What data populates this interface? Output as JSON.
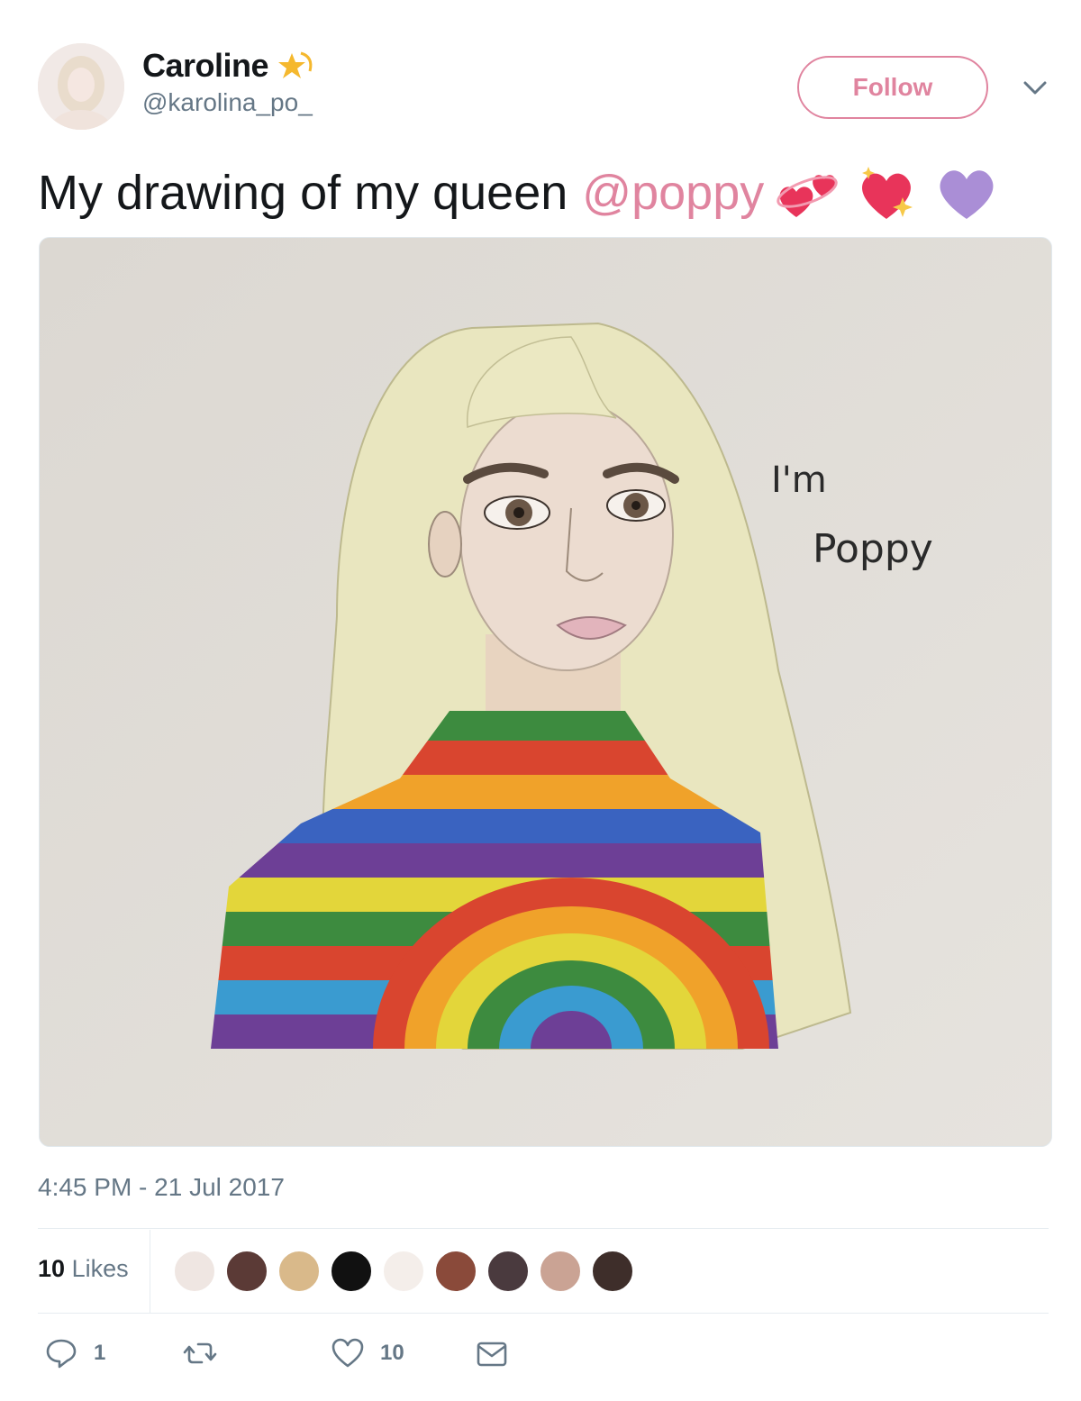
{
  "user": {
    "display_name": "Caroline",
    "handle": "@karolina_po_",
    "follow_label": "Follow"
  },
  "tweet": {
    "text": "My drawing of my queen",
    "mention": "@poppy",
    "drawing_text": {
      "line1": "I'm",
      "line2": "Poppy"
    }
  },
  "meta": {
    "timestamp": "4:45 PM - 21 Jul 2017"
  },
  "stats": {
    "likes_count": "10",
    "likes_label": "Likes"
  },
  "actions": {
    "reply_count": "1",
    "like_count": "10"
  },
  "colors": {
    "accent": "#e0849f",
    "secondary_text": "#657786"
  },
  "icons": [
    "star-icon",
    "chevron-down-icon",
    "reply-icon",
    "retweet-icon",
    "heart-icon",
    "mail-icon"
  ]
}
